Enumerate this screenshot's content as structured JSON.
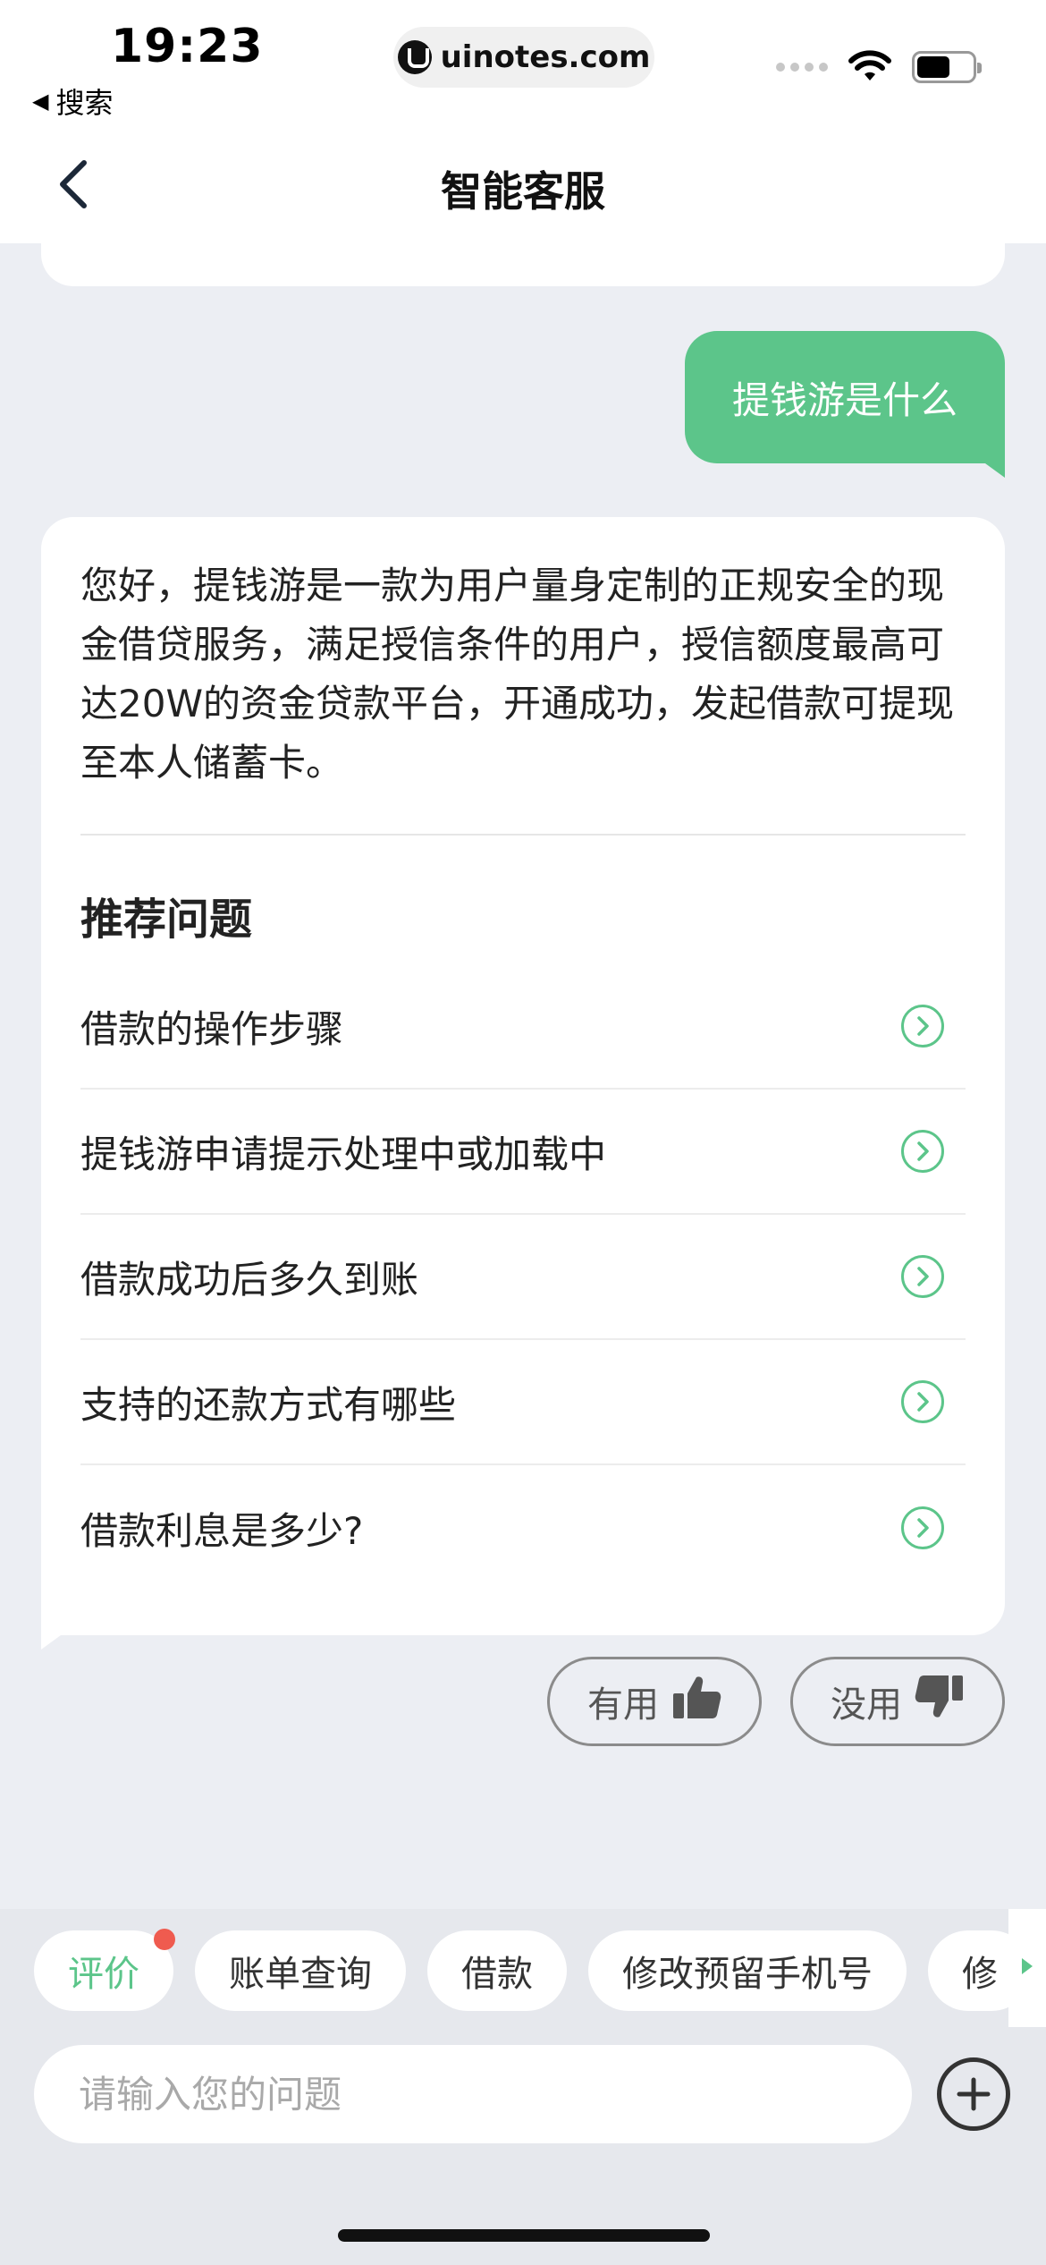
{
  "status_bar": {
    "time": "19:23",
    "back_app": "搜索",
    "url": "uinotes.com"
  },
  "nav": {
    "title": "智能客服",
    "back_icon": "chevron-left-icon"
  },
  "chat": {
    "user_message": "提钱游是什么",
    "bot_answer": "您好，提钱游是一款为用户量身定制的正规安全的现金借贷服务，满足授信条件的用户，授信额度最高可达20W的资金贷款平台，开通成功，发起借款可提现至本人储蓄卡。",
    "recommend_title": "推荐问题",
    "recommend_items": [
      {
        "label": "借款的操作步骤"
      },
      {
        "label": "提钱游申请提示处理中或加载中"
      },
      {
        "label": "借款成功后多久到账"
      },
      {
        "label": "支持的还款方式有哪些"
      },
      {
        "label": "借款利息是多少?"
      }
    ],
    "feedback": {
      "useful_label": "有用",
      "useless_label": "没用"
    }
  },
  "quick_chips": [
    {
      "label": "评价",
      "active": true
    },
    {
      "label": "账单查询"
    },
    {
      "label": "借款"
    },
    {
      "label": "修改预留手机号"
    },
    {
      "label": "修"
    }
  ],
  "input": {
    "placeholder": "请输入您的问题"
  },
  "colors": {
    "accent": "#5cc58a",
    "badge": "#ef5b4f",
    "background": "#eceef3"
  }
}
